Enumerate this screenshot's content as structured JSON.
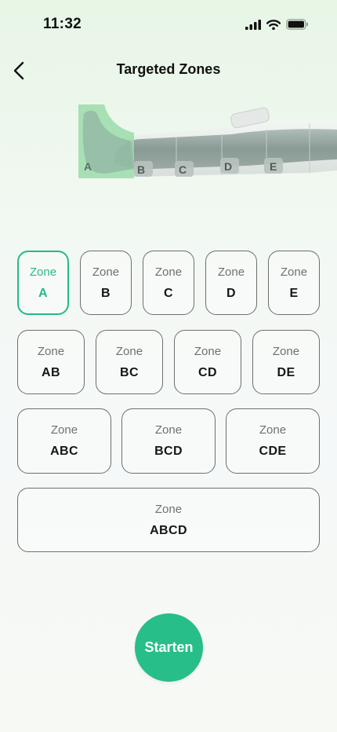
{
  "status": {
    "time": "11:32"
  },
  "nav": {
    "title": "Targeted Zones"
  },
  "illustration": {
    "labels": [
      "A",
      "B",
      "C",
      "D",
      "E"
    ]
  },
  "zones": {
    "word": "Zone",
    "selected": "A",
    "rows": [
      [
        "A",
        "B",
        "C",
        "D",
        "E"
      ],
      [
        "AB",
        "BC",
        "CD",
        "DE"
      ],
      [
        "ABC",
        "BCD",
        "CDE"
      ],
      [
        "ABCD"
      ]
    ]
  },
  "start": {
    "label": "Starten"
  },
  "colors": {
    "accent": "#26b98a",
    "start_button": "#27be89"
  }
}
